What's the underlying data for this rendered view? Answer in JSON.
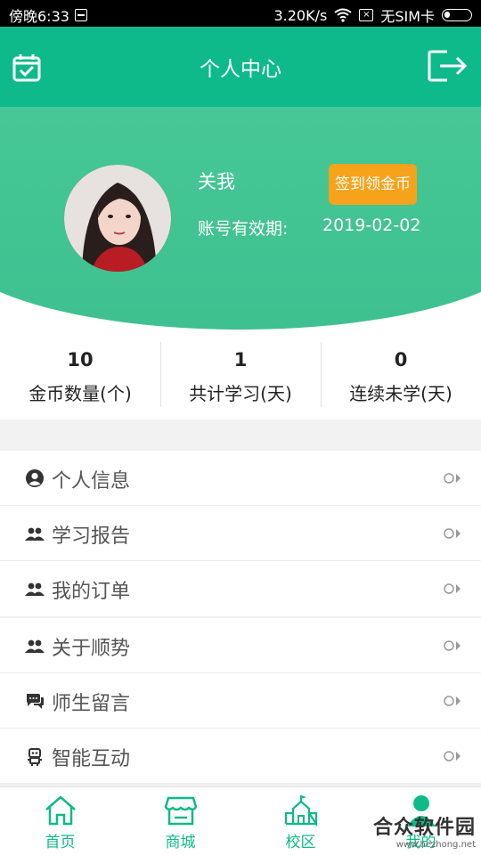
{
  "status_bar": {
    "time": "傍晚6:33",
    "speed": "3.20K/s",
    "sim": "无SIM卡"
  },
  "header": {
    "title": "个人中心",
    "left_icon": "calendar-check-icon",
    "right_icon": "logout-icon"
  },
  "profile": {
    "name": "关我",
    "expire_label": "账号有效期:",
    "expire_date": "2019-02-02",
    "signin_button": "签到领金币"
  },
  "stats": [
    {
      "value": "10",
      "label": "金币数量(个)"
    },
    {
      "value": "1",
      "label": "共计学习(天)"
    },
    {
      "value": "0",
      "label": "连续未学(天)"
    }
  ],
  "menu_group1": [
    {
      "label": "个人信息",
      "icon": "user-circle-icon"
    },
    {
      "label": "学习报告",
      "icon": "users-icon"
    },
    {
      "label": "我的订单",
      "icon": "users-icon"
    }
  ],
  "menu_group2": [
    {
      "label": "关于顺势",
      "icon": "users-icon"
    },
    {
      "label": "师生留言",
      "icon": "chat-icon"
    },
    {
      "label": "智能互动",
      "icon": "robot-icon"
    }
  ],
  "tabs": [
    {
      "label": "首页",
      "icon": "home-icon"
    },
    {
      "label": "商城",
      "icon": "store-icon"
    },
    {
      "label": "校区",
      "icon": "school-icon"
    },
    {
      "label": "我的",
      "icon": "person-icon"
    }
  ],
  "watermark": {
    "title": "合众软件园",
    "url": "www.hezhong.net"
  },
  "colors": {
    "primary": "#0fba8a",
    "hero": "#4ccd99",
    "accent": "#f7a21b"
  }
}
